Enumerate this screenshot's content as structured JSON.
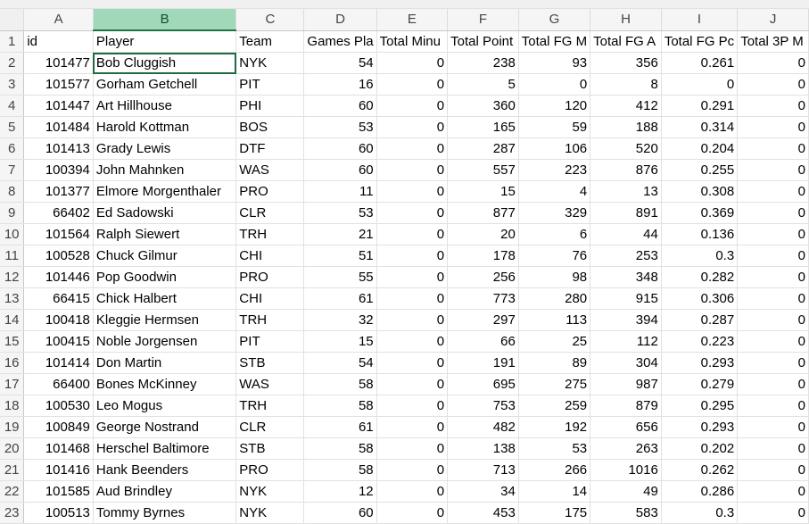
{
  "columns": [
    "A",
    "B",
    "C",
    "D",
    "E",
    "F",
    "G",
    "H",
    "I",
    "J"
  ],
  "selected_column": "B",
  "header_row": [
    "id",
    "Player",
    "Team",
    "Games Pla",
    "Total Minu",
    "Total Point",
    "Total FG M",
    "Total FG A",
    "Total FG Pc",
    "Total 3P M"
  ],
  "rows": [
    [
      "101477",
      "Bob Cluggish",
      "NYK",
      "54",
      "0",
      "238",
      "93",
      "356",
      "0.261",
      "0"
    ],
    [
      "101577",
      "Gorham Getchell",
      "PIT",
      "16",
      "0",
      "5",
      "0",
      "8",
      "0",
      "0"
    ],
    [
      "101447",
      "Art Hillhouse",
      "PHI",
      "60",
      "0",
      "360",
      "120",
      "412",
      "0.291",
      "0"
    ],
    [
      "101484",
      "Harold Kottman",
      "BOS",
      "53",
      "0",
      "165",
      "59",
      "188",
      "0.314",
      "0"
    ],
    [
      "101413",
      "Grady Lewis",
      "DTF",
      "60",
      "0",
      "287",
      "106",
      "520",
      "0.204",
      "0"
    ],
    [
      "100394",
      "John Mahnken",
      "WAS",
      "60",
      "0",
      "557",
      "223",
      "876",
      "0.255",
      "0"
    ],
    [
      "101377",
      "Elmore Morgenthaler",
      "PRO",
      "11",
      "0",
      "15",
      "4",
      "13",
      "0.308",
      "0"
    ],
    [
      "66402",
      "Ed Sadowski",
      "CLR",
      "53",
      "0",
      "877",
      "329",
      "891",
      "0.369",
      "0"
    ],
    [
      "101564",
      "Ralph Siewert",
      "TRH",
      "21",
      "0",
      "20",
      "6",
      "44",
      "0.136",
      "0"
    ],
    [
      "100528",
      "Chuck Gilmur",
      "CHI",
      "51",
      "0",
      "178",
      "76",
      "253",
      "0.3",
      "0"
    ],
    [
      "101446",
      "Pop Goodwin",
      "PRO",
      "55",
      "0",
      "256",
      "98",
      "348",
      "0.282",
      "0"
    ],
    [
      "66415",
      "Chick Halbert",
      "CHI",
      "61",
      "0",
      "773",
      "280",
      "915",
      "0.306",
      "0"
    ],
    [
      "100418",
      "Kleggie Hermsen",
      "TRH",
      "32",
      "0",
      "297",
      "113",
      "394",
      "0.287",
      "0"
    ],
    [
      "100415",
      "Noble Jorgensen",
      "PIT",
      "15",
      "0",
      "66",
      "25",
      "112",
      "0.223",
      "0"
    ],
    [
      "101414",
      "Don Martin",
      "STB",
      "54",
      "0",
      "191",
      "89",
      "304",
      "0.293",
      "0"
    ],
    [
      "66400",
      "Bones McKinney",
      "WAS",
      "58",
      "0",
      "695",
      "275",
      "987",
      "0.279",
      "0"
    ],
    [
      "100530",
      "Leo Mogus",
      "TRH",
      "58",
      "0",
      "753",
      "259",
      "879",
      "0.295",
      "0"
    ],
    [
      "100849",
      "George Nostrand",
      "CLR",
      "61",
      "0",
      "482",
      "192",
      "656",
      "0.293",
      "0"
    ],
    [
      "101468",
      "Herschel Baltimore",
      "STB",
      "58",
      "0",
      "138",
      "53",
      "263",
      "0.202",
      "0"
    ],
    [
      "101416",
      "Hank Beenders",
      "PRO",
      "58",
      "0",
      "713",
      "266",
      "1016",
      "0.262",
      "0"
    ],
    [
      "101585",
      "Aud Brindley",
      "NYK",
      "12",
      "0",
      "34",
      "14",
      "49",
      "0.286",
      "0"
    ],
    [
      "100513",
      "Tommy Byrnes",
      "NYK",
      "60",
      "0",
      "453",
      "175",
      "583",
      "0.3",
      "0"
    ]
  ]
}
